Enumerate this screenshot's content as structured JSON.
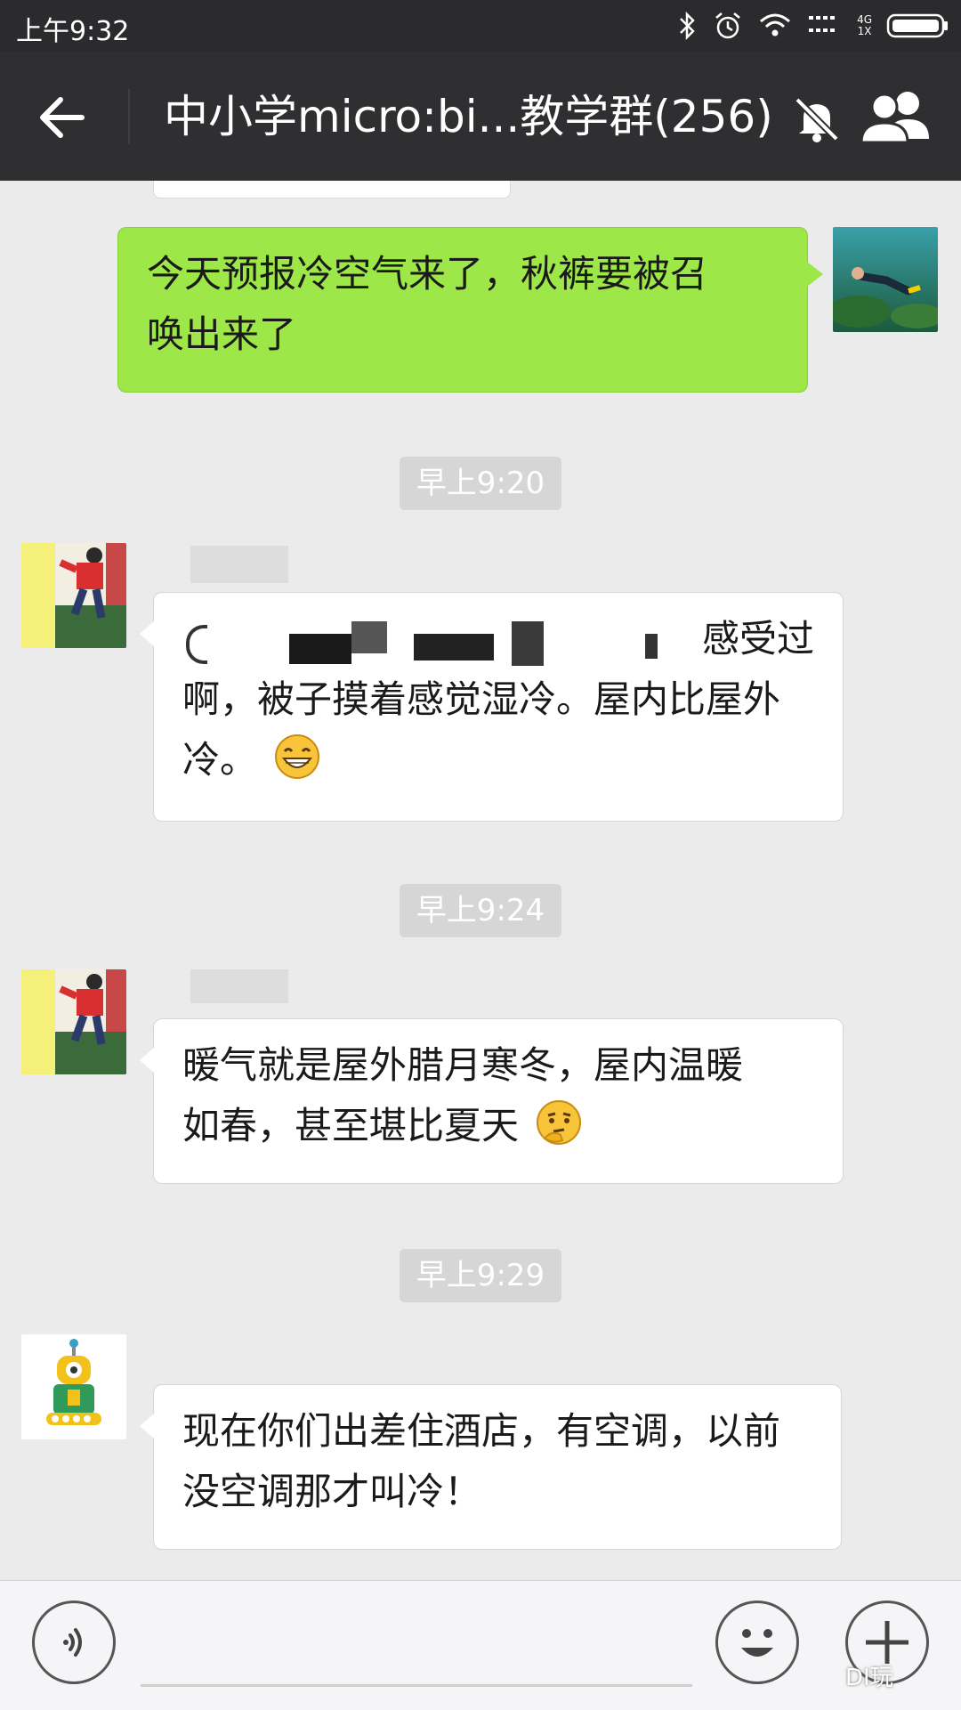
{
  "status_bar": {
    "time": "上午9:32",
    "network_top": "4G",
    "network_bottom": "1X",
    "icons": [
      "bluetooth-icon",
      "alarm-icon",
      "wifi-icon",
      "signal-icon",
      "battery-icon"
    ]
  },
  "header": {
    "title": "中小学micro:bi...教学群(256)",
    "icons": [
      "back-arrow-icon",
      "mute-bell-icon",
      "group-members-icon"
    ]
  },
  "messages": [
    {
      "direction": "out",
      "text_line1": "今天预报冷空气来了，秋裤要被召",
      "text_line2": "唤出来了",
      "avatar": "swimmer-photo"
    },
    {
      "timestamp": "早上9:20",
      "direction": "in",
      "text_line1_visible": "感受过",
      "text_line2": "啊，被子摸着感觉湿冷。屋内比屋外",
      "text_line3": "冷。",
      "emoji": "grin-emoji",
      "avatar": "child-climbing-photo"
    },
    {
      "timestamp": "早上9:24",
      "direction": "in",
      "text_line1": "暖气就是屋外腊月寒冬，屋内温暖",
      "text_line2": "如春，甚至堪比夏天",
      "emoji": "thinking-emoji",
      "avatar": "child-climbing-photo"
    },
    {
      "timestamp": "早上9:29",
      "direction": "in",
      "text_line1": "现在你们出差住酒店，有空调，以前",
      "text_line2": "没空调那才叫冷！",
      "avatar": "robot-logo"
    }
  ],
  "input_bar": {
    "icons": [
      "voice-icon",
      "emoji-icon",
      "plus-icon"
    ],
    "watermark": "DI玩"
  },
  "colors": {
    "status_bar_bg": "#2b2b2d",
    "title_bar_bg": "#2f2f31",
    "chat_bg": "#ebebeb",
    "outgoing_bubble": "#9ee748",
    "incoming_bubble": "#ffffff",
    "timestamp_bg": "#d6d6d6"
  }
}
